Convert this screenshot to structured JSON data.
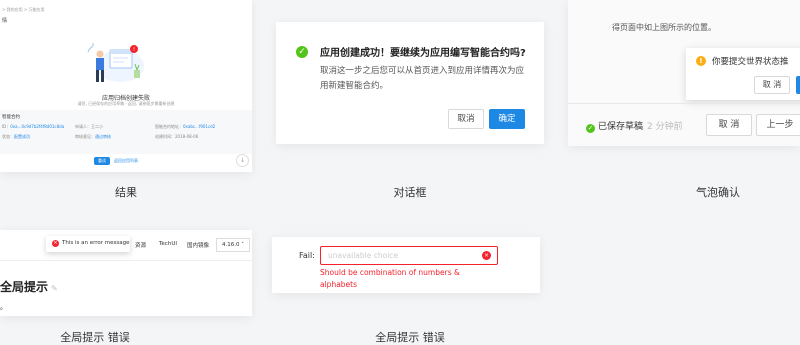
{
  "result": {
    "breadcrumb": "> 我的应用 > 万能应用",
    "page_heading": "情",
    "title": "应用归档创建失败",
    "desc": "请您, 已经保存的应用草稿 · 返回, 请参照步骤重新创建",
    "info_heading": "智能合约",
    "fields": [
      {
        "k": "ID",
        "v": "0xa...0c9d7b2f4f8d01c8da"
      },
      {
        "k": "申请人",
        "v": "王二小"
      },
      {
        "k": "智能合约地址",
        "v": "0xabc...f901cd2"
      },
      {
        "k": "状态",
        "v": "配置成功"
      },
      {
        "k": "审核意见",
        "v": "通过审核"
      },
      {
        "k": "创建时间",
        "v": "2018-08-06"
      }
    ],
    "primary_btn": "重试",
    "secondary_btn": "返回应用列表"
  },
  "dialog": {
    "title": "应用创建成功！要继续为应用编写智能合约吗?",
    "body": "取消这一步之后您可以从首页进入到应用详情再次为应用新建智能合约。",
    "cancel": "取消",
    "confirm": "确定"
  },
  "popconfirm": {
    "hint": "得页面中如上图所示的位置。",
    "question": "你要提交世界状态推",
    "cancel": "取 消",
    "saved": "已保存草稿",
    "ago": "2 分钟前",
    "cancel_btn": "取 消",
    "prev_btn": "上一步"
  },
  "global_msg": {
    "message": "This is an error message",
    "nav": [
      "资源",
      "TechUI",
      "国内镜像"
    ],
    "version": "4.16.0",
    "title": "全局提示",
    "dot": "。"
  },
  "form_error": {
    "label": "Fail:",
    "placeholder": "unavailable choice",
    "error": "Should be combination of numbers & alphabets"
  },
  "captions": {
    "result": "结果",
    "dialog": "对话框",
    "pop": "气泡确认",
    "global": "全局提示 错误",
    "form": "全局提示 错误"
  },
  "colors": {
    "primary": "#1e88e5",
    "success": "#52c41a",
    "warning": "#faad14",
    "error": "#f5222d"
  }
}
